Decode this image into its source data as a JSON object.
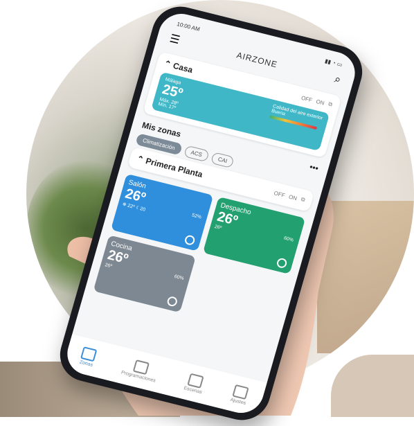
{
  "status": {
    "time": "10:00 AM"
  },
  "header": {
    "logo": "AIRZONE"
  },
  "home": {
    "title": "Casa",
    "off": "OFF",
    "on": "ON",
    "weather": {
      "city": "Málaga",
      "temp": "25º",
      "max": "Máx. 28º",
      "min": "Mín. 17º",
      "air_label": "Calidad del aire exterior",
      "air_value": "Buena"
    }
  },
  "zones_title": "Mis zonas",
  "pills": [
    "Climatización",
    "ACS",
    "CAI"
  ],
  "floor": {
    "title": "Primera Planta",
    "off": "OFF",
    "on": "ON"
  },
  "zones": [
    {
      "name": "Salón",
      "temp": "26º",
      "hum": "52%",
      "set": "22º",
      "extra": "20",
      "color": "#2f8fdc"
    },
    {
      "name": "Despacho",
      "temp": "26º",
      "hum": "60%",
      "set": "26º",
      "extra": "",
      "color": "#22a06f"
    },
    {
      "name": "Cocina",
      "temp": "26º",
      "hum": "60%",
      "set": "26º",
      "extra": "",
      "color": "#7e8892"
    }
  ],
  "nav": [
    "Zonas",
    "Programaciones",
    "Escenas",
    "Ajustes"
  ]
}
